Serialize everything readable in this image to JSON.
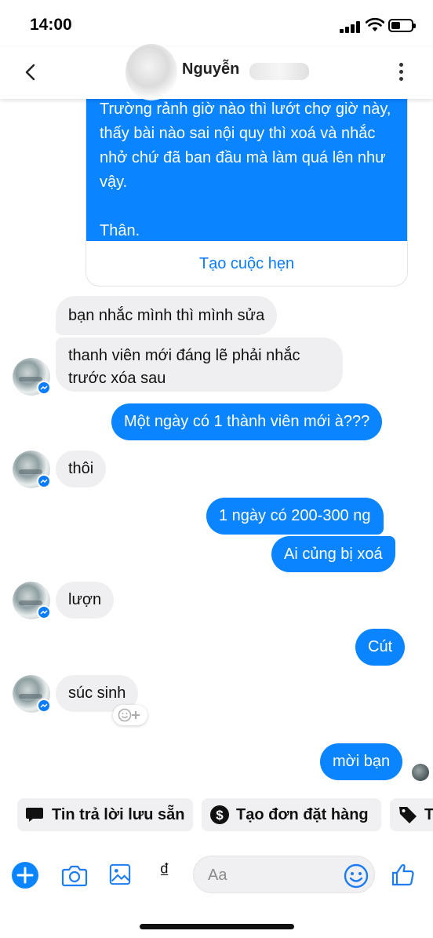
{
  "status_bar": {
    "time": "14:00"
  },
  "header": {
    "contact_name": "Nguyễn"
  },
  "card": {
    "message": "Trường rảnh giờ nào thì lướt chợ giờ này, thấy bài nào sai nội quy thì xoá và nhắc nhở chứ đã ban đầu mà làm quá lên như vậy.\n\nThân.",
    "button_label": "Tạo cuộc hẹn",
    "color": "#0a84ff"
  },
  "messages": [
    {
      "from": "them",
      "text": "bạn nhắc mình thì mình sửa"
    },
    {
      "from": "them",
      "text": "thanh viên mới đáng lẽ phải nhắc trước xóa sau"
    },
    {
      "from": "me",
      "text": "Một ngày có 1 thành viên mới à???"
    },
    {
      "from": "them",
      "text": "thôi"
    },
    {
      "from": "me",
      "text": "1 ngày có 200-300 ng"
    },
    {
      "from": "me",
      "text": "Ai củng bị xoá"
    },
    {
      "from": "them",
      "text": "lượn"
    },
    {
      "from": "me",
      "text": "Cút"
    },
    {
      "from": "them",
      "text": "súc sinh"
    },
    {
      "from": "me",
      "text": "mời bạn"
    }
  ],
  "quick_replies": [
    {
      "label": "Tin trả lời lưu sẵn",
      "icon": "saved-reply-icon"
    },
    {
      "label": "Tạo đơn đặt hàng",
      "icon": "dollar-icon"
    },
    {
      "label": "T",
      "icon": "tag-icon"
    }
  ],
  "composer": {
    "placeholder": "Aa",
    "currency_symbol": "₫",
    "icons": [
      "plus-icon",
      "camera-icon",
      "gallery-icon",
      "currency-icon",
      "emoji-icon",
      "like-icon"
    ]
  },
  "colors": {
    "accent": "#0a84ff",
    "incoming_bubble": "#efeff1"
  }
}
